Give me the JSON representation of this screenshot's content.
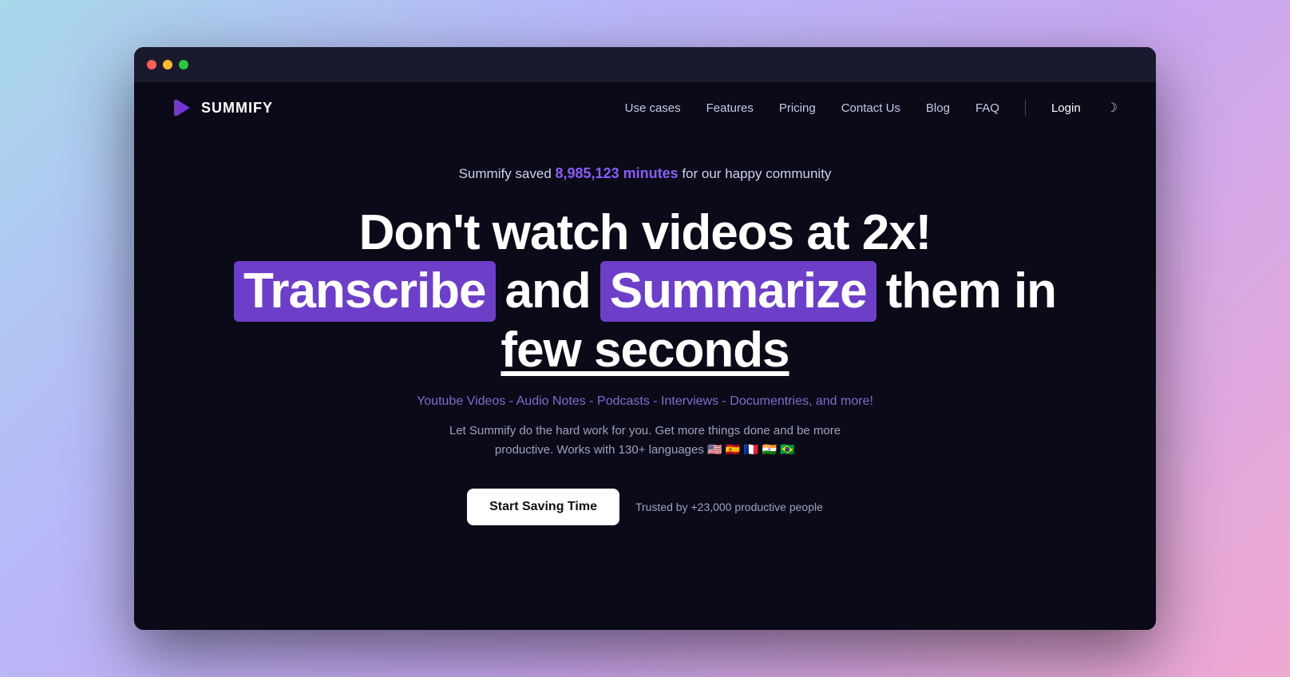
{
  "browser": {
    "traffic_lights": [
      "red",
      "yellow",
      "green"
    ]
  },
  "nav": {
    "logo_text": "SUMMIFY",
    "links": [
      "Use cases",
      "Features",
      "Pricing",
      "Contact Us",
      "Blog",
      "FAQ"
    ],
    "login_label": "Login"
  },
  "hero": {
    "stat_prefix": "Summify saved ",
    "stat_number": "8,985,123 minutes",
    "stat_suffix": " for our happy community",
    "title_line1": "Don't watch videos at 2x!",
    "title_highlight1": "Transcribe",
    "title_and": "and",
    "title_highlight2": "Summarize",
    "title_line2_suffix": " them in",
    "title_line3": "few seconds",
    "subtitle_features": "Youtube Videos - Audio Notes - Podcasts - Interviews - Documentries, and more!",
    "subtitle_desc": "Let Summify do the hard work for you. Get more things done and be more",
    "subtitle_desc2": "productive. Works with 130+ languages 🇺🇸 🇪🇸 🇫🇷 🇮🇳 🇧🇷",
    "cta_button": "Start Saving Time",
    "trusted_text": "Trusted by +23,000 productive people"
  }
}
